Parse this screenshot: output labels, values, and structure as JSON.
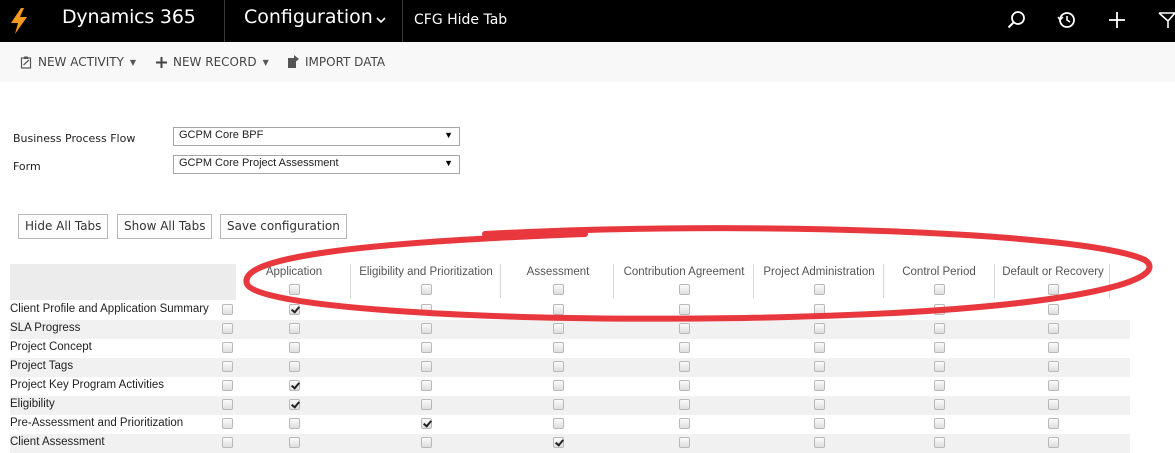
{
  "topbar": {
    "app_title": "Dynamics 365",
    "area_title": "Configuration",
    "entity_title": "CFG Hide Tab"
  },
  "commands": {
    "new_activity": "NEW ACTIVITY",
    "new_record": "NEW RECORD",
    "import_data": "IMPORT DATA"
  },
  "form": {
    "bpf_label": "Business Process Flow",
    "bpf_value": "GCPM Core BPF",
    "form_label": "Form",
    "form_value": "GCPM Core Project Assessment"
  },
  "actions": {
    "hide_all": "Hide All Tabs",
    "show_all": "Show All Tabs",
    "save": "Save configuration"
  },
  "grid": {
    "columns": [
      "Application",
      "Eligibility and Prioritization",
      "Assessment",
      "Contribution Agreement",
      "Project Administration",
      "Control Period",
      "Default or Recovery"
    ],
    "rows": [
      {
        "name": "Client Profile and Application Summary",
        "checked": [
          true,
          false,
          false,
          false,
          false,
          false,
          false
        ]
      },
      {
        "name": "SLA Progress",
        "checked": [
          false,
          false,
          false,
          false,
          false,
          false,
          false
        ]
      },
      {
        "name": "Project Concept",
        "checked": [
          false,
          false,
          false,
          false,
          false,
          false,
          false
        ]
      },
      {
        "name": "Project Tags",
        "checked": [
          false,
          false,
          false,
          false,
          false,
          false,
          false
        ]
      },
      {
        "name": "Project Key Program Activities",
        "checked": [
          true,
          false,
          false,
          false,
          false,
          false,
          false
        ]
      },
      {
        "name": "Eligibility",
        "checked": [
          true,
          false,
          false,
          false,
          false,
          false,
          false
        ]
      },
      {
        "name": "Pre-Assessment and Prioritization",
        "checked": [
          false,
          true,
          false,
          false,
          false,
          false,
          false
        ]
      },
      {
        "name": "Client Assessment",
        "checked": [
          false,
          false,
          true,
          false,
          false,
          false,
          false
        ]
      }
    ]
  },
  "annotation_color": "#e8383d"
}
